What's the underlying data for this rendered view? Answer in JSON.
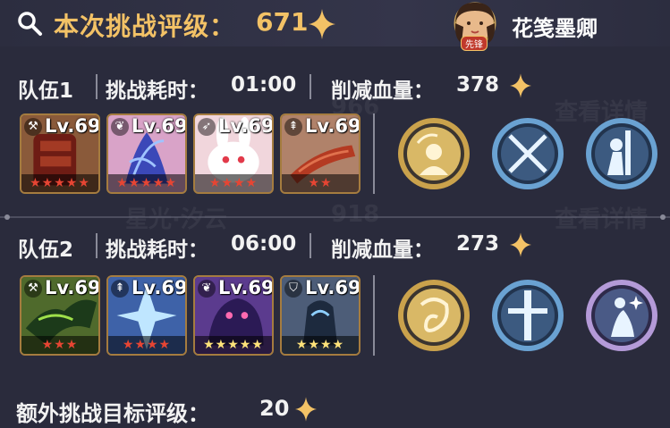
{
  "header": {
    "search_icon": "search-icon",
    "rating_label": "本次挑战评级：",
    "rating_value": "671",
    "player_name": "花笺墨卿",
    "vanguard_badge": "先锋"
  },
  "teams": [
    {
      "name": "队伍1",
      "time_label": "挑战耗时：",
      "time_value": "01:00",
      "damage_label": "削减血量：",
      "damage_value": "378",
      "heroes": [
        {
          "level": "Lv.69",
          "class_icon": "axe-icon",
          "stars": "★★★★★",
          "star_color": "red",
          "art": "red-bracer"
        },
        {
          "level": "Lv.69",
          "class_icon": "sprout-icon",
          "stars": "★★★★★",
          "star_color": "red",
          "art": "blue-plant"
        },
        {
          "level": "Lv.69",
          "class_icon": "feather-icon",
          "stars": "★★★★",
          "star_color": "red",
          "art": "white-rabbit"
        },
        {
          "level": "Lv.69",
          "class_icon": "tree-icon",
          "stars": "★★",
          "star_color": "red",
          "art": "red-sausage"
        }
      ],
      "skills": [
        "monk-skill-icon",
        "crossed-swords-skill-icon",
        "warrior-blade-skill-icon"
      ]
    },
    {
      "name": "队伍2",
      "time_label": "挑战耗时：",
      "time_value": "06:00",
      "damage_label": "削减血量：",
      "damage_value": "273",
      "heroes": [
        {
          "level": "Lv.69",
          "class_icon": "axe-icon",
          "stars": "★★★",
          "star_color": "red",
          "art": "green-dragon"
        },
        {
          "level": "Lv.69",
          "class_icon": "tree-icon",
          "stars": "★★★★",
          "star_color": "red",
          "art": "ice-spirit"
        },
        {
          "level": "Lv.69",
          "class_icon": "sprout-icon",
          "stars": "★★★★★",
          "star_color": "gold",
          "art": "purple-beast"
        },
        {
          "level": "Lv.69",
          "class_icon": "shield-icon",
          "stars": "★★★★",
          "star_color": "gold",
          "art": "blue-knight"
        }
      ],
      "skills": [
        "swirl-creature-skill-icon",
        "blade-strike-skill-icon",
        "dancer-skill-icon"
      ]
    }
  ],
  "extra": {
    "label": "额外挑战目标评级：",
    "value": "20"
  },
  "colors": {
    "gold_text": "#f3c266",
    "background": "#2a2b3c",
    "red_star": "#e64533",
    "gold_star": "#ffe37a"
  }
}
